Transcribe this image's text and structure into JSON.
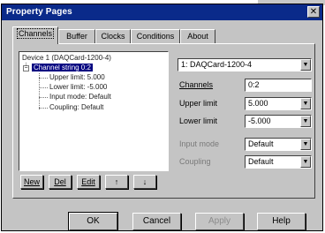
{
  "window": {
    "title": "Property Pages",
    "close_glyph": "✕"
  },
  "tabs": [
    {
      "label": "Channels",
      "active": true
    },
    {
      "label": "Buffer"
    },
    {
      "label": "Clocks"
    },
    {
      "label": "Conditions"
    },
    {
      "label": "About"
    }
  ],
  "tree": {
    "root": "Device 1 (DAQCard-1200-4)",
    "selected": "Channel string 0:2",
    "children": [
      "Upper limit: 5.000",
      "Lower limit: -5.000",
      "Input mode: Default",
      "Coupling: Default"
    ]
  },
  "tree_buttons": {
    "new": "New",
    "del": "Del",
    "edit": "Edit",
    "up": "↑",
    "down": "↓"
  },
  "device_combo": {
    "value": "1: DAQCard-1200-4"
  },
  "fields": {
    "channels": {
      "label": "Channels",
      "value": "0:2"
    },
    "upper_limit": {
      "label": "Upper limit",
      "value": "5.000"
    },
    "lower_limit": {
      "label": "Lower limit",
      "value": "-5.000"
    },
    "input_mode": {
      "label": "Input mode",
      "value": "Default"
    },
    "coupling": {
      "label": "Coupling",
      "value": "Default"
    }
  },
  "buttons": {
    "ok": "OK",
    "cancel": "Cancel",
    "apply": "Apply",
    "help": "Help"
  }
}
